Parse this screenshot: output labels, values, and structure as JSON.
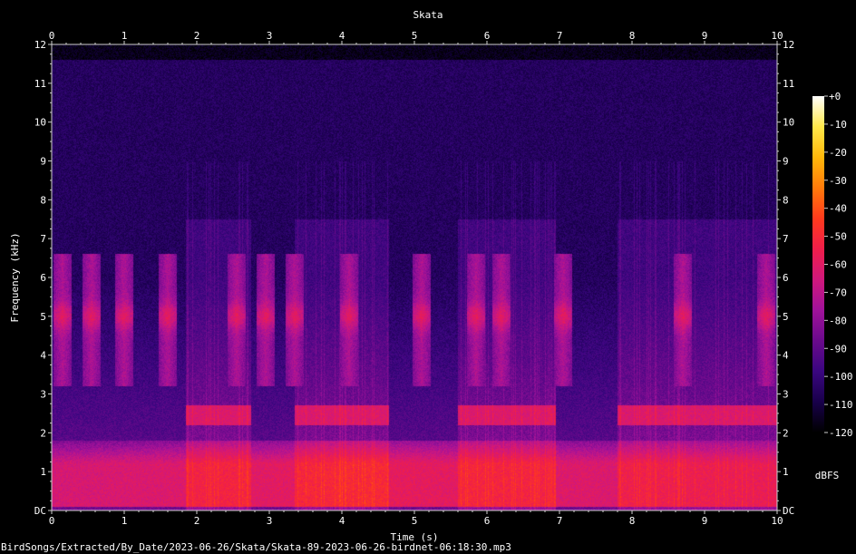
{
  "chart_data": {
    "type": "heatmap",
    "title": "Skata",
    "xlabel": "Time (s)",
    "ylabel": "Frequency (kHz)",
    "xlim": [
      0,
      10
    ],
    "ylim": [
      0,
      12
    ],
    "x_ticks": [
      "0",
      "1",
      "2",
      "3",
      "4",
      "5",
      "6",
      "7",
      "8",
      "9",
      "10"
    ],
    "y_ticks": [
      "DC",
      "1",
      "2",
      "3",
      "4",
      "5",
      "6",
      "7",
      "8",
      "9",
      "10",
      "11",
      "12"
    ],
    "colorbar": {
      "label": "dBFS",
      "range": [
        -120,
        0
      ],
      "ticks": [
        "+0",
        "-10",
        "-20",
        "-30",
        "-40",
        "-50",
        "-60",
        "-70",
        "-80",
        "-90",
        "-100",
        "-110",
        "-120"
      ],
      "colormap": [
        "#000000",
        "#18004a",
        "#3a0680",
        "#6a0a8c",
        "#a0129a",
        "#d0187c",
        "#f01e4a",
        "#ff3a1c",
        "#ff7a0a",
        "#ffb80a",
        "#ffe84a",
        "#ffffff"
      ]
    },
    "background_level_dbfs": -105,
    "rolloff_above_khz": 11.6,
    "low_freq_band": {
      "freq_khz": [
        0.1,
        1.2
      ],
      "level_dbfs": -58
    },
    "loud_segments": [
      {
        "t": [
          1.85,
          2.75
        ],
        "band_khz": [
          2.2,
          2.7
        ],
        "level_dbfs": -62
      },
      {
        "t": [
          3.35,
          4.65
        ],
        "band_khz": [
          2.2,
          2.7
        ],
        "level_dbfs": -62
      },
      {
        "t": [
          5.6,
          6.95
        ],
        "band_khz": [
          2.2,
          2.7
        ],
        "level_dbfs": -62
      },
      {
        "t": [
          7.8,
          10.0
        ],
        "band_khz": [
          2.2,
          2.7
        ],
        "level_dbfs": -62
      }
    ],
    "calls": [
      {
        "t": 0.15,
        "freq_khz": 5.0,
        "level_dbfs": -65
      },
      {
        "t": 0.55,
        "freq_khz": 5.0,
        "level_dbfs": -65
      },
      {
        "t": 1.0,
        "freq_khz": 5.0,
        "level_dbfs": -65
      },
      {
        "t": 1.6,
        "freq_khz": 5.0,
        "level_dbfs": -65
      },
      {
        "t": 2.55,
        "freq_khz": 5.0,
        "level_dbfs": -65
      },
      {
        "t": 2.95,
        "freq_khz": 5.0,
        "level_dbfs": -65
      },
      {
        "t": 3.35,
        "freq_khz": 5.0,
        "level_dbfs": -65
      },
      {
        "t": 4.1,
        "freq_khz": 5.0,
        "level_dbfs": -65
      },
      {
        "t": 5.1,
        "freq_khz": 5.0,
        "level_dbfs": -65
      },
      {
        "t": 5.85,
        "freq_khz": 5.0,
        "level_dbfs": -65
      },
      {
        "t": 6.2,
        "freq_khz": 5.0,
        "level_dbfs": -65
      },
      {
        "t": 7.05,
        "freq_khz": 5.0,
        "level_dbfs": -65
      },
      {
        "t": 8.7,
        "freq_khz": 5.0,
        "level_dbfs": -65
      },
      {
        "t": 9.85,
        "freq_khz": 5.0,
        "level_dbfs": -65
      }
    ]
  },
  "file_path": "BirdSongs/Extracted/By_Date/2023-06-26/Skata/Skata-89-2023-06-26-birdnet-06:18:30.mp3"
}
